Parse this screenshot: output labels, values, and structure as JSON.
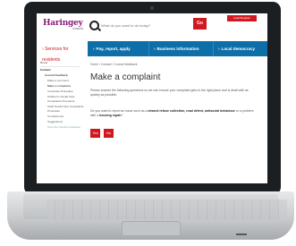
{
  "header": {
    "logo_main": "Haringey",
    "logo_sub": "LONDON",
    "search_placeholder": "What do you want to do today?",
    "search_button": "Go",
    "login_button": "Login/Register"
  },
  "sidebar": {
    "title": "Services for residents",
    "items": [
      {
        "label": "Home",
        "level": 0
      },
      {
        "label": "Contact",
        "level": 0
      },
      {
        "label": "Council feedback",
        "level": 1
      },
      {
        "label": "Make a comment",
        "level": 2
      },
      {
        "label": "Make a complaint",
        "level": 2
      },
      {
        "label": "Corporate Procedure",
        "level": 2
      },
      {
        "label": "Children's Social Care",
        "level": 2
      },
      {
        "label": "Complaints Procedure",
        "level": 2
      },
      {
        "label": "Adult Social Care Complaints",
        "level": 2
      },
      {
        "label": "Procedure",
        "level": 2
      },
      {
        "label": "Compliments",
        "level": 2
      },
      {
        "label": "Suggestions",
        "level": 2
      },
      {
        "label": "How We Handle Feedback",
        "level": 2
      }
    ]
  },
  "nav": {
    "items": [
      {
        "label": "Pay, report, apply"
      },
      {
        "label": "Business information"
      },
      {
        "label": "Local democracy"
      }
    ]
  },
  "main": {
    "breadcrumb": "Home / Contact / Council feedback",
    "title": "Make a complaint",
    "paragraph1": "Please answer the following questions so we can ensure your complaint gets to the right place and is dealt with as quickly as possible.",
    "paragraph2_pre": "Do you want to report an issue such as a ",
    "paragraph2_bold": "missed refuse collection, road defect, antisocial behaviour",
    "paragraph2_mid": " or a problem with a ",
    "paragraph2_bold2": "housing repair",
    "paragraph2_post": "?",
    "yes_button": "Yes",
    "no_button": "No"
  }
}
